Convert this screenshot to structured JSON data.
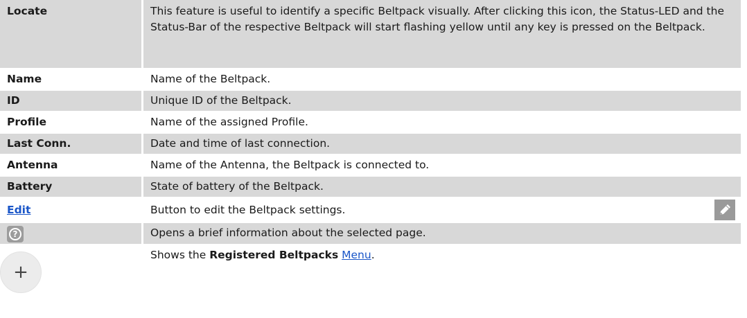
{
  "rows": [
    {
      "term": "Locate",
      "desc": "This feature is useful to identify a specific Beltpack visually. After clicking this icon, the Status-LED and the Status-Bar of the respective Beltpack will start flashing yellow until any key is pressed on the Beltpack."
    },
    {
      "term": "Name",
      "desc": "Name of the Beltpack."
    },
    {
      "term": "ID",
      "desc": "Unique ID of the Beltpack."
    },
    {
      "term": "Profile",
      "desc": "Name of the assigned Profile."
    },
    {
      "term": "Last Conn.",
      "desc": "Date and time of last connection."
    },
    {
      "term": "Antenna",
      "desc": "Name of the Antenna, the Beltpack is connected to."
    },
    {
      "term": "Battery",
      "desc": "State of battery of the Beltpack."
    },
    {
      "term": "Edit",
      "desc": "Button to edit the Beltpack settings.",
      "icon": "pencil-icon"
    },
    {
      "term_icon": "help-icon",
      "term_glyph": "?",
      "desc": "Opens a brief information about the selected page."
    },
    {
      "term_icon": "plus-icon",
      "term_glyph": "+",
      "desc_prefix": "Shows the ",
      "desc_bold": "Registered Beltpacks",
      "desc_space": " ",
      "desc_link": "Menu",
      "desc_suffix": "."
    }
  ],
  "colors": {
    "row_shade": "#d8d8d8",
    "link": "#1a56c8",
    "icon_gray": "#9a9a9a"
  }
}
